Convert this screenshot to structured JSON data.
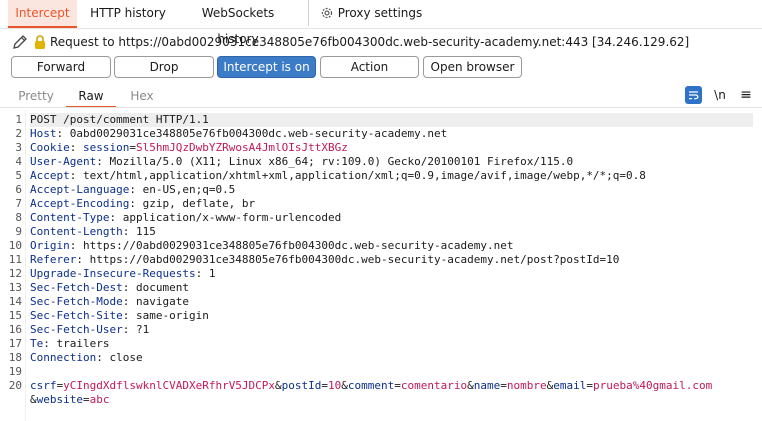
{
  "tabs": {
    "intercept": "Intercept",
    "http_history": "HTTP history",
    "websockets_history": "WebSockets history",
    "proxy_settings": "Proxy settings"
  },
  "request_line": "Request to https://0abd0029031ce348805e76fb004300dc.web-security-academy.net:443  [34.246.129.62]",
  "buttons": {
    "forward": "Forward",
    "drop": "Drop",
    "intercept": "Intercept is on",
    "action": "Action",
    "open_browser": "Open browser"
  },
  "view_tabs": {
    "pretty": "Pretty",
    "raw": "Raw",
    "hex": "Hex"
  },
  "tools": {
    "newline": "\\n",
    "menu": "≡"
  },
  "request": {
    "first_line": "POST /post/comment HTTP/1.1",
    "headers": [
      {
        "num": "2",
        "name": "Host",
        "value": "0abd0029031ce348805e76fb004300dc.web-security-academy.net"
      },
      {
        "num": "3",
        "name": "Cookie",
        "cookie_name": "session",
        "cookie_value": "Sl5hmJQzDwbYZRwosA4JmlOIsJttXBGz"
      },
      {
        "num": "4",
        "name": "User-Agent",
        "value": "Mozilla/5.0 (X11; Linux x86_64; rv:109.0) Gecko/20100101 Firefox/115.0"
      },
      {
        "num": "5",
        "name": "Accept",
        "value": "text/html,application/xhtml+xml,application/xml;q=0.9,image/avif,image/webp,*/*;q=0.8"
      },
      {
        "num": "6",
        "name": "Accept-Language",
        "value": "en-US,en;q=0.5"
      },
      {
        "num": "7",
        "name": "Accept-Encoding",
        "value": "gzip, deflate, br"
      },
      {
        "num": "8",
        "name": "Content-Type",
        "value": "application/x-www-form-urlencoded"
      },
      {
        "num": "9",
        "name": "Content-Length",
        "value": "115"
      },
      {
        "num": "10",
        "name": "Origin",
        "value": "https://0abd0029031ce348805e76fb004300dc.web-security-academy.net"
      },
      {
        "num": "11",
        "name": "Referer",
        "value": "https://0abd0029031ce348805e76fb004300dc.web-security-academy.net/post?postId=10"
      },
      {
        "num": "12",
        "name": "Upgrade-Insecure-Requests",
        "value": "1"
      },
      {
        "num": "13",
        "name": "Sec-Fetch-Dest",
        "value": "document"
      },
      {
        "num": "14",
        "name": "Sec-Fetch-Mode",
        "value": "navigate"
      },
      {
        "num": "15",
        "name": "Sec-Fetch-Site",
        "value": "same-origin"
      },
      {
        "num": "16",
        "name": "Sec-Fetch-User",
        "value": "?1"
      },
      {
        "num": "17",
        "name": "Te",
        "value": "trailers"
      },
      {
        "num": "18",
        "name": "Connection",
        "value": "close"
      }
    ],
    "blank_line_num": "19",
    "body_line_num": "20",
    "body_params": [
      {
        "name": "csrf",
        "value": "yCIngdXdflswknlCVADXeRfhrV5JDCPx"
      },
      {
        "name": "postId",
        "value": "10"
      },
      {
        "name": "comment",
        "value": "comentario"
      },
      {
        "name": "name",
        "value": "nombre"
      },
      {
        "name": "email",
        "value": "prueba%40gmail.com"
      },
      {
        "name": "website",
        "value": "abc"
      }
    ]
  },
  "colors": {
    "accent": "#e8562a",
    "primary_button": "#3c7bc6",
    "header_name": "#0c2f8c",
    "value_red": "#c2185b"
  }
}
